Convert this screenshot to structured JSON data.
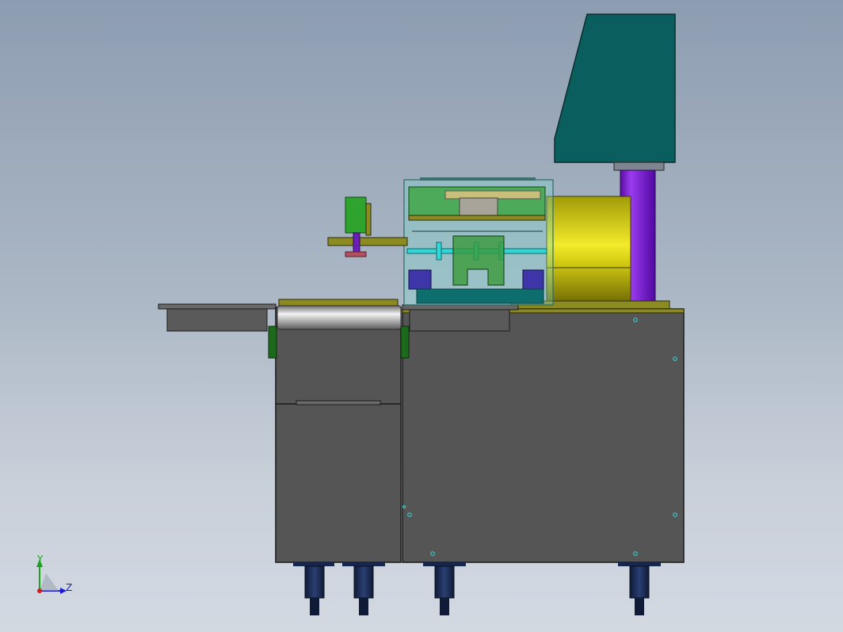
{
  "viewport": {
    "background_top": "#8d9db1",
    "background_bottom": "#d3d9e1"
  },
  "triad": {
    "y_label": "Y",
    "z_label": "Z",
    "y_color": "#1aa31a",
    "z_color": "#1c1ccc",
    "x_color": "#cc1c1c"
  },
  "model": {
    "colors": {
      "body_gray": "#555555",
      "edge": "#1a1a1a",
      "teal_housing": "#0b5e5e",
      "purple_column": "#7a16c8",
      "yellow_cylinder": "#c9c20a",
      "olive_plate": "#8b8b22",
      "green_block": "#2ea32e",
      "cyan_rod": "#33d6d6",
      "navy_foot": "#16264d",
      "blue_block": "#3d35a8",
      "dark_green_bracket": "#1d6a1d",
      "transparent_guard": "#7fd6cf"
    },
    "parts": {
      "main_cabinet": "main-cabinet",
      "left_cabinet": "left-cabinet",
      "roller": "roller",
      "left_tray": "left-tray",
      "motor_housing": "motor-housing",
      "motor_column": "motor-column",
      "yellow_cylinder": "yellow-cylinder",
      "guard_box": "guard-box",
      "green_valve": "green-valve",
      "foot": "leveling-foot"
    }
  }
}
